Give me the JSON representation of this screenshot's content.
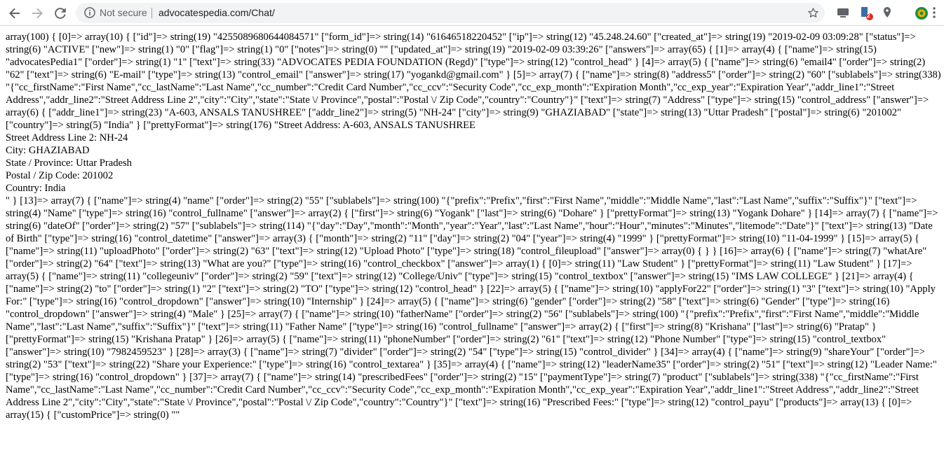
{
  "browser": {
    "security_label": "Not secure",
    "url": "advocatespedia.com/Chat/",
    "extension_badge": "2"
  },
  "page": {
    "lines": [
      "array(100) { [0]=> array(10) { [\"id\"]=> string(19) \"4255089680644084571\" [\"form_id\"]=> string(14) \"61646518220452\" [\"ip\"]=> string(12) \"45.248.24.60\" [\"created_at\"]=> string(19) \"2019-02-09 03:09:28\" [\"status\"]=> string(6) \"ACTIVE\" [\"new\"]=> string(1) \"0\" [\"flag\"]=> string(1) \"0\" [\"notes\"]=> string(0) \"\" [\"updated_at\"]=> string(19) \"2019-02-09 03:39:26\" [\"answers\"]=> array(65) { [1]=> array(4) { [\"name\"]=> string(15) \"advocatesPedia1\" [\"order\"]=> string(1) \"1\" [\"text\"]=> string(33) \"ADVOCATES PEDIA FOUNDATION (Regd)\" [\"type\"]=> string(12) \"control_head\" } [4]=> array(5) { [\"name\"]=> string(6) \"email4\" [\"order\"]=> string(2) \"62\" [\"text\"]=> string(6) \"E-mail\" [\"type\"]=> string(13) \"control_email\" [\"answer\"]=> string(17) \"yogankd@gmail.com\" } [5]=> array(7) { [\"name\"]=> string(8) \"address5\" [\"order\"]=> string(2) \"60\" [\"sublabels\"]=> string(338) \"{\"cc_firstName\":\"First Name\",\"cc_lastName\":\"Last Name\",\"cc_number\":\"Credit Card Number\",\"cc_ccv\":\"Security Code\",\"cc_exp_month\":\"Expiration Month\",\"cc_exp_year\":\"Expiration Year\",\"addr_line1\":\"Street Address\",\"addr_line2\":\"Street Address Line 2\",\"city\":\"City\",\"state\":\"State \\/ Province\",\"postal\":\"Postal \\/ Zip Code\",\"country\":\"Country\"}\" [\"text\"]=> string(7) \"Address\" [\"type\"]=> string(15) \"control_address\" [\"answer\"]=> array(6) { [\"addr_line1\"]=> string(23) \"A-603, ANSALS TANUSHREE\" [\"addr_line2\"]=> string(5) \"NH-24\" [\"city\"]=> string(9) \"GHAZIABAD\" [\"state\"]=> string(13) \"Uttar Pradesh\" [\"postal\"]=> string(6) \"201002\" [\"country\"]=> string(5) \"India\" } [\"prettyFormat\"]=> string(176) \"Street Address: A-603, ANSALS TANUSHREE",
      "Street Address Line 2: NH-24",
      "City: GHAZIABAD",
      "State / Province: Uttar Pradesh",
      "Postal / Zip Code: 201002",
      "Country: India",
      "\" } [13]=> array(7) { [\"name\"]=> string(4) \"name\" [\"order\"]=> string(2) \"55\" [\"sublabels\"]=> string(100) \"{\"prefix\":\"Prefix\",\"first\":\"First Name\",\"middle\":\"Middle Name\",\"last\":\"Last Name\",\"suffix\":\"Suffix\"}\" [\"text\"]=> string(4) \"Name\" [\"type\"]=> string(16) \"control_fullname\" [\"answer\"]=> array(2) { [\"first\"]=> string(6) \"Yogank\" [\"last\"]=> string(6) \"Dohare\" } [\"prettyFormat\"]=> string(13) \"Yogank Dohare\" } [14]=> array(7) { [\"name\"]=> string(6) \"dateOf\" [\"order\"]=> string(2) \"57\" [\"sublabels\"]=> string(114) \"{\"day\":\"Day\",\"month\":\"Month\",\"year\":\"Year\",\"last\":\"Last Name\",\"hour\":\"Hour\",\"minutes\":\"Minutes\",\"litemode\":\"Date\"}\" [\"text\"]=> string(13) \"Date of Birth\" [\"type\"]=> string(16) \"control_datetime\" [\"answer\"]=> array(3) { [\"month\"]=> string(2) \"11\" [\"day\"]=> string(2) \"04\" [\"year\"]=> string(4) \"1999\" } [\"prettyFormat\"]=> string(10) \"11-04-1999\" } [15]=> array(5) { [\"name\"]=> string(11) \"uploadPhoto\" [\"order\"]=> string(2) \"63\" [\"text\"]=> string(12) \"Upload Photo\" [\"type\"]=> string(18) \"control_fileupload\" [\"answer\"]=> array(0) { } } [16]=> array(6) { [\"name\"]=> string(7) \"whatAre\" [\"order\"]=> string(2) \"64\" [\"text\"]=> string(13) \"What are you?\" [\"type\"]=> string(16) \"control_checkbox\" [\"answer\"]=> array(1) { [0]=> string(11) \"Law Student\" } [\"prettyFormat\"]=> string(11) \"Law Student\" } [17]=> array(5) { [\"name\"]=> string(11) \"collegeuniv\" [\"order\"]=> string(2) \"59\" [\"text\"]=> string(12) \"College/Univ\" [\"type\"]=> string(15) \"control_textbox\" [\"answer\"]=> string(15) \"IMS LAW COLLEGE\" } [21]=> array(4) { [\"name\"]=> string(2) \"to\" [\"order\"]=> string(1) \"2\" [\"text\"]=> string(2) \"TO\" [\"type\"]=> string(12) \"control_head\" } [22]=> array(5) { [\"name\"]=> string(10) \"applyFor22\" [\"order\"]=> string(1) \"3\" [\"text\"]=> string(10) \"Apply For:\" [\"type\"]=> string(16) \"control_dropdown\" [\"answer\"]=> string(10) \"Internship\" } [24]=> array(5) { [\"name\"]=> string(6) \"gender\" [\"order\"]=> string(2) \"58\" [\"text\"]=> string(6) \"Gender\" [\"type\"]=> string(16) \"control_dropdown\" [\"answer\"]=> string(4) \"Male\" } [25]=> array(7) { [\"name\"]=> string(10) \"fatherName\" [\"order\"]=> string(2) \"56\" [\"sublabels\"]=> string(100) \"{\"prefix\":\"Prefix\",\"first\":\"First Name\",\"middle\":\"Middle Name\",\"last\":\"Last Name\",\"suffix\":\"Suffix\"}\" [\"text\"]=> string(11) \"Father Name\" [\"type\"]=> string(16) \"control_fullname\" [\"answer\"]=> array(2) { [\"first\"]=> string(8) \"Krishana\" [\"last\"]=> string(6) \"Pratap\" } [\"prettyFormat\"]=> string(15) \"Krishana Pratap\" } [26]=> array(5) { [\"name\"]=> string(11) \"phoneNumber\" [\"order\"]=> string(2) \"61\" [\"text\"]=> string(12) \"Phone Number\" [\"type\"]=> string(15) \"control_textbox\" [\"answer\"]=> string(10) \"7982459523\" } [28]=> array(3) { [\"name\"]=> string(7) \"divider\" [\"order\"]=> string(2) \"54\" [\"type\"]=> string(15) \"control_divider\" } [34]=> array(4) { [\"name\"]=> string(9) \"shareYour\" [\"order\"]=> string(2) \"53\" [\"text\"]=> string(22) \"Share your Experience:\" [\"type\"]=> string(16) \"control_textarea\" } [35]=> array(4) { [\"name\"]=> string(12) \"leaderName35\" [\"order\"]=> string(2) \"51\" [\"text\"]=> string(12) \"Leader Name:\" [\"type\"]=> string(16) \"control_dropdown\" } [37]=> array(7) { [\"name\"]=> string(14) \"prescribedFees\" [\"order\"]=> string(2) \"15\" [\"paymentType\"]=> string(7) \"product\" [\"sublabels\"]=> string(338) \"{\"cc_firstName\":\"First Name\",\"cc_lastName\":\"Last Name\",\"cc_number\":\"Credit Card Number\",\"cc_ccv\":\"Security Code\",\"cc_exp_month\":\"Expiration Month\",\"cc_exp_year\":\"Expiration Year\",\"addr_line1\":\"Street Address\",\"addr_line2\":\"Street Address Line 2\",\"city\":\"City\",\"state\":\"State \\/ Province\",\"postal\":\"Postal \\/ Zip Code\",\"country\":\"Country\"}\" [\"text\"]=> string(16) \"Prescribed Fees:\" [\"type\"]=> string(12) \"control_payu\" [\"products\"]=> array(13) { [0]=> array(15) { [\"customPrice\"]=> string(0) \"\""
    ]
  }
}
